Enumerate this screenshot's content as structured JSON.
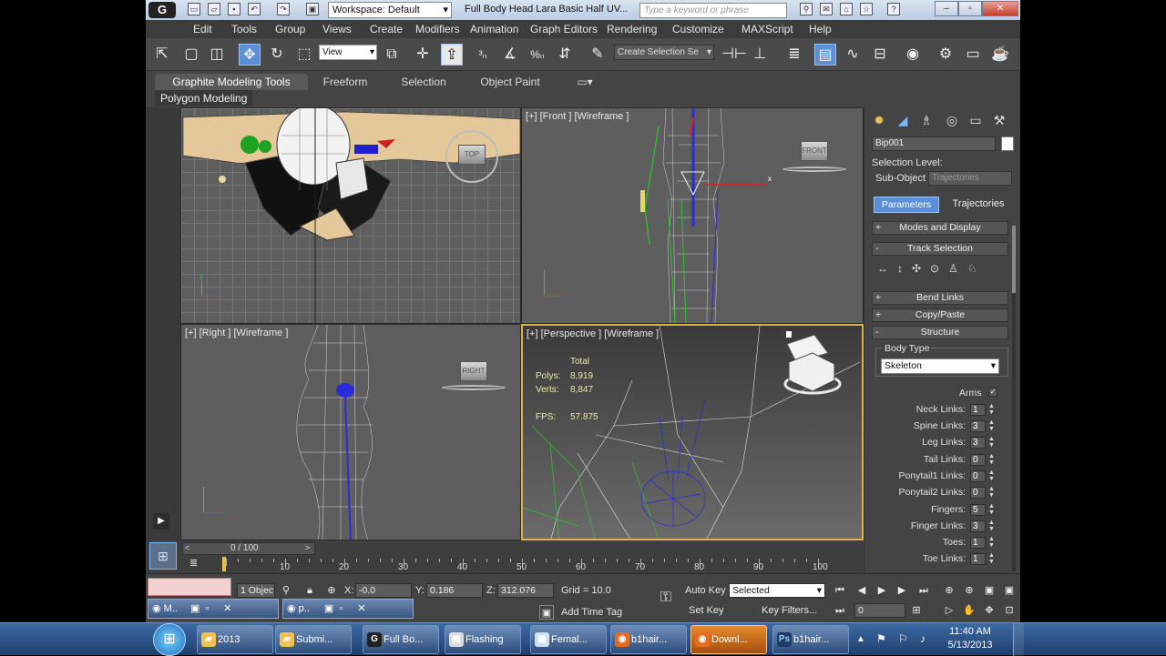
{
  "titlebar": {
    "workspace": "Workspace: Default",
    "doc_title": "Full Body Head Lara Basic Half UV...",
    "search_placeholder": "Type a keyword or phrase",
    "logo": "G"
  },
  "menu": [
    "Edit",
    "Tools",
    "Group",
    "Views",
    "Create",
    "Modifiers",
    "Animation",
    "Graph Editors",
    "Rendering",
    "Customize",
    "MAXScript",
    "Help"
  ],
  "toolbar": {
    "view_select": "View",
    "named_selection": "Create Selection Se"
  },
  "ribbon": {
    "tabs": [
      "Graphite Modeling Tools",
      "Freeform",
      "Selection",
      "Object Paint"
    ],
    "panel": "Polygon Modeling"
  },
  "viewports": {
    "top_left": {
      "label": ""
    },
    "front": {
      "label": "[+] [Front ] [Wireframe ]",
      "cube": "FRONT"
    },
    "right": {
      "label": "[+] [Right ] [Wireframe ]",
      "cube": "RIGHT"
    },
    "perspective": {
      "label": "[+] [Perspective ] [Wireframe ]",
      "stats_header": "Total",
      "polys_label": "Polys:",
      "polys_value": "8,919",
      "verts_label": "Verts:",
      "verts_value": "8,847",
      "fps_label": "FPS:",
      "fps_value": "57.875"
    },
    "top_cube": "TOP"
  },
  "command_panel": {
    "object_name": "Bip001",
    "selection_level": "Selection Level:",
    "sub_object_label": "Sub-Object",
    "sub_object_value": "Trajectories",
    "tab_parameters": "Parameters",
    "tab_trajectories": "Trajectories",
    "rollouts": {
      "modes": "Modes and Display",
      "track_selection": "Track Selection",
      "bend_links": "Bend Links",
      "copy_paste": "Copy/Paste",
      "structure": "Structure"
    },
    "body_type_label": "Body Type",
    "body_type_value": "Skeleton",
    "arms_label": "Arms",
    "arms_checked": true,
    "params": [
      {
        "label": "Neck Links:",
        "value": "1"
      },
      {
        "label": "Spine Links:",
        "value": "3"
      },
      {
        "label": "Leg Links:",
        "value": "3"
      },
      {
        "label": "Tail Links:",
        "value": "0"
      },
      {
        "label": "Ponytail1 Links:",
        "value": "0"
      },
      {
        "label": "Ponytail2 Links:",
        "value": "0"
      },
      {
        "label": "Fingers:",
        "value": "5"
      },
      {
        "label": "Finger Links:",
        "value": "3"
      },
      {
        "label": "Toes:",
        "value": "1"
      },
      {
        "label": "Toe Links:",
        "value": "1"
      }
    ]
  },
  "timeline": {
    "frame_counter": "0 / 100",
    "ruler": [
      "0",
      "10",
      "20",
      "30",
      "40",
      "50",
      "60",
      "70",
      "80",
      "90",
      "100"
    ]
  },
  "status": {
    "selected_count": "1 Objec",
    "x_label": "X:",
    "x_value": "-0.0",
    "y_label": "Y:",
    "y_value": "0.186",
    "z_label": "Z:",
    "z_value": "312.076",
    "grid": "Grid = 10.0",
    "add_time_tag": "Add Time Tag",
    "auto_key": "Auto Key",
    "set_key": "Set Key",
    "key_mode": "Selected",
    "key_filters": "Key Filters...",
    "current_frame": "0",
    "mini_tabs": [
      "M..",
      "p.."
    ]
  },
  "taskbar": {
    "items": [
      {
        "label": "2013",
        "glyph": "folder",
        "color": "#f2c14e"
      },
      {
        "label": "Submi...",
        "glyph": "folder",
        "color": "#f2c14e"
      },
      {
        "label": "Full Bo...",
        "glyph": "3ds",
        "color": "#222"
      },
      {
        "label": "Flashing",
        "glyph": "app",
        "color": "#ddd"
      },
      {
        "label": "Femal...",
        "glyph": "window",
        "color": "#cfe1f5"
      },
      {
        "label": "b1hair...",
        "glyph": "firefox",
        "color": "#e66b1f"
      },
      {
        "label": "Downl...",
        "glyph": "firefox",
        "color": "#e66b1f"
      },
      {
        "label": "b1hair...",
        "glyph": "PS",
        "color": "#1e3a66"
      }
    ],
    "active_index": 6,
    "time": "11:40 AM",
    "date": "5/13/2013"
  },
  "colors": {
    "viewport_bg": "#5e5e5e",
    "accent_blue": "#5b8fd6",
    "perspective_border": "#d8b34a"
  }
}
